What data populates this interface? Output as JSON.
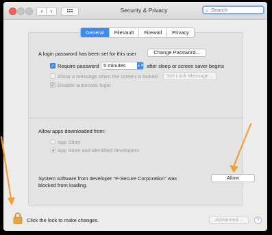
{
  "window": {
    "title": "Security & Privacy",
    "nav_back": "‹",
    "nav_forward": "›",
    "search_placeholder": "Search"
  },
  "tabs": [
    {
      "label": "General",
      "active": true
    },
    {
      "label": "FileVault",
      "active": false
    },
    {
      "label": "Firewall",
      "active": false
    },
    {
      "label": "Privacy",
      "active": false
    }
  ],
  "login": {
    "message": "A login password has been set for this user",
    "change_password_button": "Change Password...",
    "require_password_label": "Require password",
    "require_password_checked": true,
    "require_password_value": "5 minutes",
    "require_password_suffix": "after sleep or screen saver begins",
    "show_message_label": "Show a message when the screen is locked",
    "show_message_checked": false,
    "set_lock_message_button": "Set Lock Message...",
    "disable_auto_login_label": "Disable automatic login",
    "disable_auto_login_checked": true
  },
  "downloads": {
    "heading": "Allow apps downloaded from:",
    "options": [
      {
        "label": "App Store",
        "selected": false
      },
      {
        "label": "App Store and identified developers",
        "selected": true
      }
    ],
    "blocked_line1": "System software from developer “F-Secure Corporation” was",
    "blocked_line2": "blocked from loading.",
    "allow_button": "Allow"
  },
  "footer": {
    "lock_text": "Click the lock to make changes.",
    "advanced_button": "Advanced...",
    "help_button": "?"
  },
  "colors": {
    "accent": "#3b8bf6",
    "annotation_arrow": "#f0a030",
    "close_button": "#fc605c"
  }
}
